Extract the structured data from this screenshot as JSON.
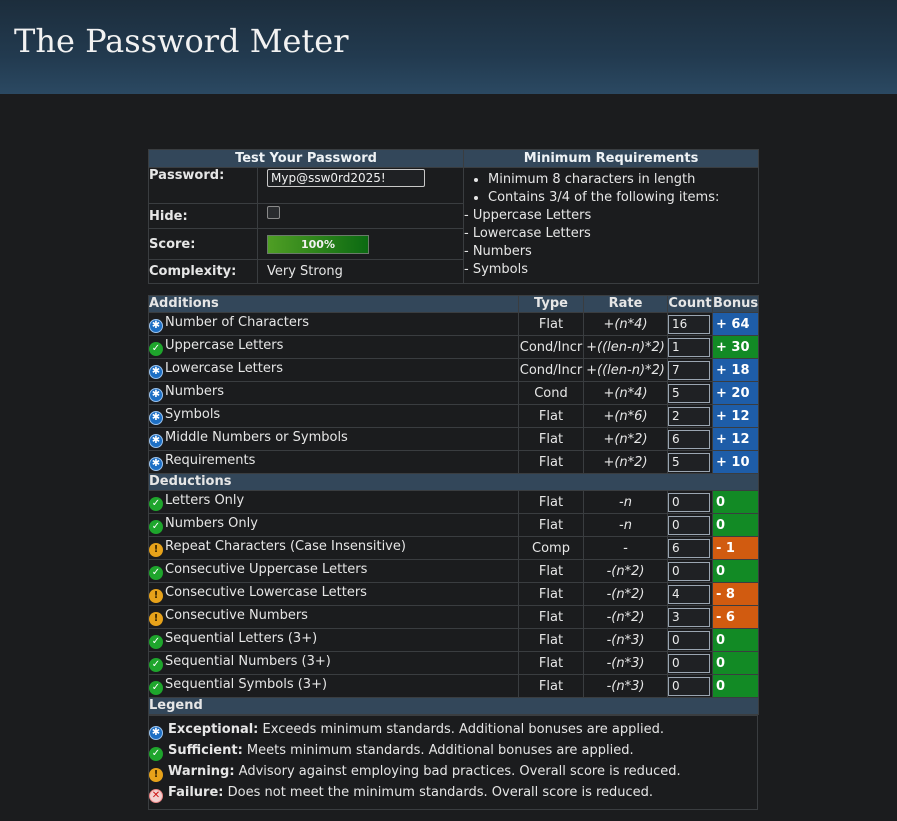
{
  "app": {
    "title": "The Password Meter"
  },
  "test": {
    "header": "Test Your Password",
    "password_label": "Password:",
    "password_value": "Myp@ssw0rd2025!",
    "hide_label": "Hide:",
    "score_label": "Score:",
    "score_value": "100%",
    "score_fraction": 1.0,
    "complexity_label": "Complexity:",
    "complexity_value": "Very Strong"
  },
  "requirements": {
    "header": "Minimum Requirements",
    "bullets": [
      "Minimum 8 characters in length",
      "Contains 3/4 of the following items:"
    ],
    "items": [
      "- Uppercase Letters",
      "- Lowercase Letters",
      "- Numbers",
      "- Symbols"
    ]
  },
  "columns": {
    "name": "Additions",
    "type": "Type",
    "rate": "Rate",
    "count": "Count",
    "bonus": "Bonus"
  },
  "additions": [
    {
      "status": "exceptional",
      "name": "Number of Characters",
      "type": "Flat",
      "rate": "+(n*4)",
      "count": "16",
      "bonus": "+ 64",
      "color": "blue"
    },
    {
      "status": "sufficient",
      "name": "Uppercase Letters",
      "type": "Cond/Incr",
      "rate": "+((len-n)*2)",
      "count": "1",
      "bonus": "+ 30",
      "color": "green"
    },
    {
      "status": "exceptional",
      "name": "Lowercase Letters",
      "type": "Cond/Incr",
      "rate": "+((len-n)*2)",
      "count": "7",
      "bonus": "+ 18",
      "color": "blue"
    },
    {
      "status": "exceptional",
      "name": "Numbers",
      "type": "Cond",
      "rate": "+(n*4)",
      "count": "5",
      "bonus": "+ 20",
      "color": "blue"
    },
    {
      "status": "exceptional",
      "name": "Symbols",
      "type": "Flat",
      "rate": "+(n*6)",
      "count": "2",
      "bonus": "+ 12",
      "color": "blue"
    },
    {
      "status": "exceptional",
      "name": "Middle Numbers or Symbols",
      "type": "Flat",
      "rate": "+(n*2)",
      "count": "6",
      "bonus": "+ 12",
      "color": "blue"
    },
    {
      "status": "exceptional",
      "name": "Requirements",
      "type": "Flat",
      "rate": "+(n*2)",
      "count": "5",
      "bonus": "+ 10",
      "color": "blue"
    }
  ],
  "deductions_title": "Deductions",
  "deductions": [
    {
      "status": "sufficient",
      "name": "Letters Only",
      "type": "Flat",
      "rate": "-n",
      "count": "0",
      "bonus": "0",
      "color": "green"
    },
    {
      "status": "sufficient",
      "name": "Numbers Only",
      "type": "Flat",
      "rate": "-n",
      "count": "0",
      "bonus": "0",
      "color": "green"
    },
    {
      "status": "warning",
      "name": "Repeat Characters (Case Insensitive)",
      "type": "Comp",
      "rate": "-",
      "count": "6",
      "bonus": "- 1",
      "color": "orange"
    },
    {
      "status": "sufficient",
      "name": "Consecutive Uppercase Letters",
      "type": "Flat",
      "rate": "-(n*2)",
      "count": "0",
      "bonus": "0",
      "color": "green"
    },
    {
      "status": "warning",
      "name": "Consecutive Lowercase Letters",
      "type": "Flat",
      "rate": "-(n*2)",
      "count": "4",
      "bonus": "- 8",
      "color": "orange"
    },
    {
      "status": "warning",
      "name": "Consecutive Numbers",
      "type": "Flat",
      "rate": "-(n*2)",
      "count": "3",
      "bonus": "- 6",
      "color": "orange"
    },
    {
      "status": "sufficient",
      "name": "Sequential Letters (3+)",
      "type": "Flat",
      "rate": "-(n*3)",
      "count": "0",
      "bonus": "0",
      "color": "green"
    },
    {
      "status": "sufficient",
      "name": "Sequential Numbers (3+)",
      "type": "Flat",
      "rate": "-(n*3)",
      "count": "0",
      "bonus": "0",
      "color": "green"
    },
    {
      "status": "sufficient",
      "name": "Sequential Symbols (3+)",
      "type": "Flat",
      "rate": "-(n*3)",
      "count": "0",
      "bonus": "0",
      "color": "green"
    }
  ],
  "legend": {
    "title": "Legend",
    "items": [
      {
        "status": "exceptional",
        "label": "Exceptional:",
        "text": " Exceeds minimum standards. Additional bonuses are applied."
      },
      {
        "status": "sufficient",
        "label": "Sufficient:",
        "text": " Meets minimum standards. Additional bonuses are applied."
      },
      {
        "status": "warning",
        "label": "Warning:",
        "text": " Advisory against employing bad practices. Overall score is reduced."
      },
      {
        "status": "failure",
        "label": "Failure:",
        "text": " Does not meet the minimum standards. Overall score is reduced."
      }
    ]
  },
  "colors": {
    "blue": "#1e5da8",
    "green": "#128a25",
    "orange": "#d15b10",
    "header": "#33475a"
  },
  "icons": {
    "exceptional": "star-badge-icon",
    "sufficient": "check-circle-icon",
    "warning": "warning-circle-icon",
    "failure": "x-circle-icon"
  }
}
